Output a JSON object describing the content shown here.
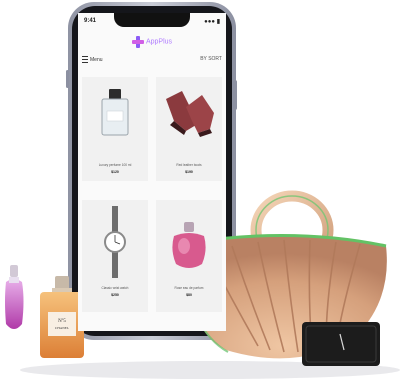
{
  "phone": {
    "status_left": "9:41",
    "status_right": "●●● ▮",
    "brand": "AppPlus",
    "menu_label": "Menu",
    "sort_label": "BY SORT"
  },
  "products": [
    {
      "name": "Luxury perfume 100 ml",
      "price": "$120"
    },
    {
      "name": "Red leather boots",
      "price": "$190"
    },
    {
      "name": "Classic wrist watch",
      "price": "$250"
    },
    {
      "name": "Rose eau de parfum",
      "price": "$80"
    }
  ],
  "colors": {
    "brand_purple": "#b07cff",
    "bag_tan": "#d8a882",
    "bag_green_trim": "#5fbf66",
    "perfume_pink": "#c65bc0",
    "perfume_amber": "#e79a4e",
    "wallet_black": "#1c1c1c"
  }
}
